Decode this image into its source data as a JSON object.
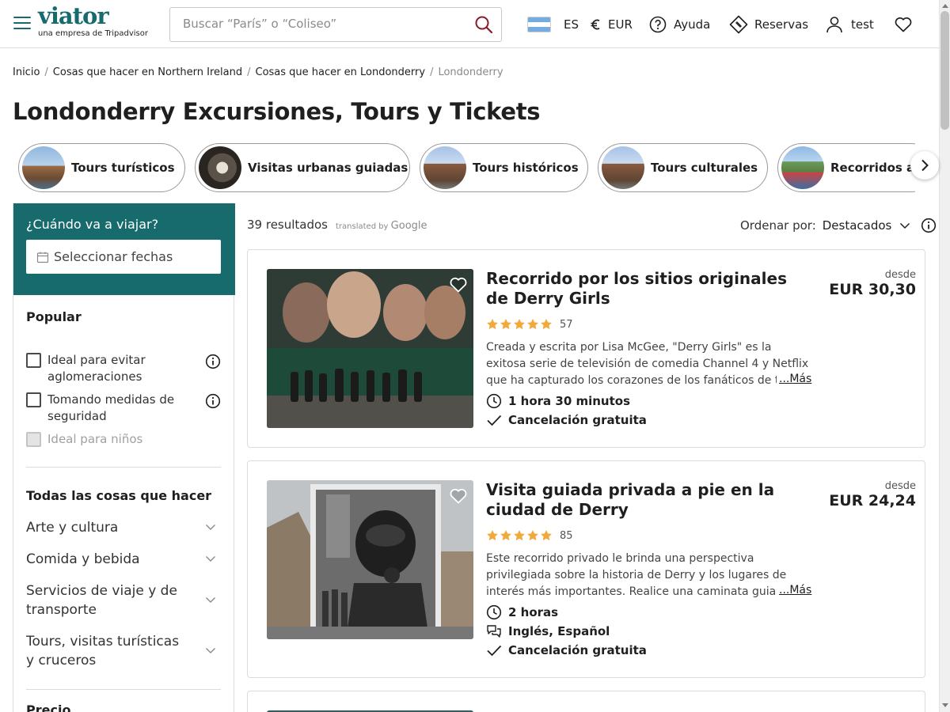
{
  "header": {
    "logo": "viator",
    "logo_sub": "una empresa de Tripadvisor",
    "search_placeholder": "Buscar “París” o “Coliseo”",
    "language": "ES",
    "currency": "EUR",
    "help": "Ayuda",
    "bookings": "Reservas",
    "user": "test"
  },
  "breadcrumb": {
    "items": [
      "Inicio",
      "Cosas que hacer en Northern Ireland",
      "Cosas que hacer en Londonderry"
    ],
    "current": "Londonderry"
  },
  "page_title": "Londonderry Excursiones, Tours y Tickets",
  "categories": [
    "Tours turísticos",
    "Visitas urbanas guiadas",
    "Tours históricos",
    "Tours culturales",
    "Recorridos a pie"
  ],
  "sidebar": {
    "when_label": "¿Cuándo va a viajar?",
    "date_placeholder": "Seleccionar fechas",
    "popular_title": "Popular",
    "popular": [
      {
        "label": "Ideal para evitar aglomeraciones",
        "disabled": false
      },
      {
        "label": "Tomando medidas de seguridad",
        "disabled": false
      },
      {
        "label": "Ideal para niños",
        "disabled": true
      }
    ],
    "all_title": "Todas las cosas que hacer",
    "accordions": [
      "Arte y cultura",
      "Comida y bebida",
      "Servicios de viaje y de transporte",
      "Tours, visitas turísticas y cruceros"
    ],
    "price_title": "Precio"
  },
  "results": {
    "count": "39 resultados",
    "translated_by": "translated by",
    "google": "Google",
    "sort_label": "Ordenar por:",
    "sort_value": "Destacados"
  },
  "products": [
    {
      "title": "Recorrido por los sitios originales de Derry Girls",
      "rating": 5,
      "reviews": "57",
      "description": "Creada y escrita por Lisa McGee, \"Derry Girls\" es la exitosa serie de televisión de comedia Channel 4 y Netflix que ha capturado los corazones de los fanáticos de todo el mundo.",
      "more": "...Más",
      "duration": "1 hora 30 minutos",
      "languages": "",
      "cancellation": "Cancelación gratuita",
      "price_from": "desde",
      "price": "EUR 30,30"
    },
    {
      "title": "Visita guiada privada a pie en la ciudad de Derry",
      "rating": 5,
      "reviews": "85",
      "description": "Este recorrido privado le brinda una perspectiva privilegiada sobre la historia de Derry y los lugares de interés más importantes. Realice una caminata guiada por la ciudad amurallada.",
      "more": "...Más",
      "duration": "2 horas",
      "languages": "Inglés, Español",
      "cancellation": "Cancelación gratuita",
      "price_from": "desde",
      "price": "EUR 24,24"
    }
  ],
  "colors": {
    "brand": "#186b6d",
    "star": "#f2a93b",
    "accent_red": "#8b1a2b"
  }
}
